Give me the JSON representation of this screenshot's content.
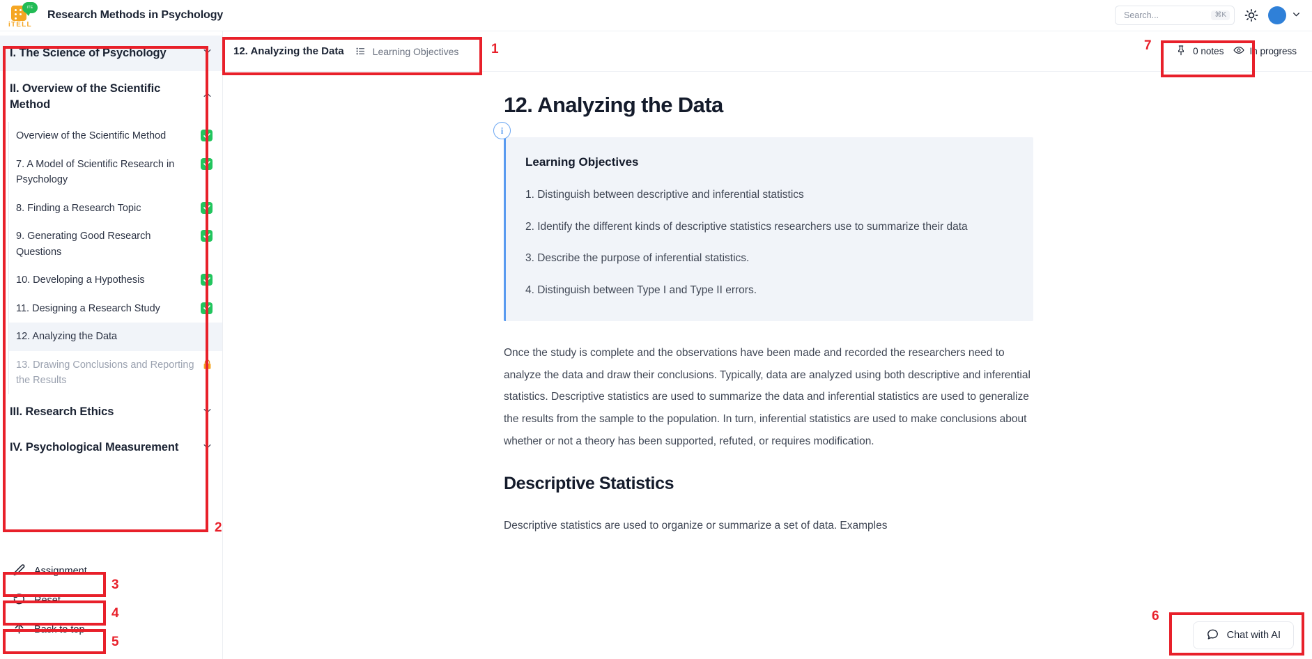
{
  "app": {
    "title": "Research Methods in Psychology",
    "logo_word": "iTELL",
    "logo_bubble_text": "iTE"
  },
  "search": {
    "placeholder": "Search...",
    "shortcut": "⌘K"
  },
  "header_icons": {
    "theme": "sun-icon",
    "avatar": "user-avatar",
    "avatar_color": "#2f80d8",
    "chevron": "chevron-down-icon"
  },
  "sidebar": {
    "sections": [
      {
        "label": "I. The Science of Psychology",
        "expanded": false,
        "chevron": "chevron-down-icon",
        "active": true,
        "items": []
      },
      {
        "label": "II. Overview of the Scientific Method",
        "expanded": true,
        "chevron": "chevron-up-icon",
        "active": false,
        "items": [
          {
            "label": "Overview of the Scientific Method",
            "status": "complete"
          },
          {
            "label": "7. A Model of Scientific Research in Psychology",
            "status": "complete"
          },
          {
            "label": "8. Finding a Research Topic",
            "status": "complete"
          },
          {
            "label": "9. Generating Good Research Questions",
            "status": "complete"
          },
          {
            "label": "10. Developing a Hypothesis",
            "status": "complete"
          },
          {
            "label": "11. Designing a Research Study",
            "status": "complete"
          },
          {
            "label": "12. Analyzing the Data",
            "status": "current"
          },
          {
            "label": "13. Drawing Conclusions and Reporting the Results",
            "status": "locked"
          }
        ]
      },
      {
        "label": "III. Research Ethics",
        "expanded": false,
        "chevron": "chevron-down-icon",
        "active": false,
        "items": []
      },
      {
        "label": "IV. Psychological Measurement",
        "expanded": false,
        "chevron": "chevron-down-icon",
        "active": false,
        "items": []
      }
    ],
    "actions": [
      {
        "label": "Assignment",
        "icon": "pencil-icon"
      },
      {
        "label": "Reset",
        "icon": "rotate-ccw-icon"
      },
      {
        "label": "Back to top",
        "icon": "arrow-up-icon"
      }
    ]
  },
  "breadcrumb": {
    "main": "12. Analyzing the Data",
    "list_icon": "list-icon",
    "sub": "Learning Objectives"
  },
  "page_status": {
    "notes_icon": "pin-icon",
    "notes_label": "0 notes",
    "progress_icon": "eye-icon",
    "progress_label": "In progress"
  },
  "main": {
    "title": "12. Analyzing the Data",
    "callout": {
      "icon": "info-icon",
      "heading": "Learning Objectives",
      "items": [
        "1. Distinguish between descriptive and inferential statistics",
        "2. Identify the different kinds of descriptive statistics researchers use to summarize their data",
        "3. Describe the purpose of inferential statistics.",
        "4. Distinguish between Type I and Type II errors."
      ]
    },
    "intro_paragraph": "Once the study is complete and the observations have been made and recorded the researchers need to analyze the data and draw their conclusions. Typically, data are analyzed using both descriptive and inferential statistics. Descriptive statistics are used to summarize the data and inferential statistics are used to generalize the results from the sample to the population. In turn, inferential statistics are used to make conclusions about whether or not a theory has been supported, refuted, or requires modification.",
    "section_heading": "Descriptive Statistics",
    "section_paragraph": "Descriptive statistics are used to organize or summarize a set of data. Examples"
  },
  "chat": {
    "icon": "chat-bubble-icon",
    "label": "Chat with AI"
  },
  "annotations": [
    {
      "number": "1"
    },
    {
      "number": "2"
    },
    {
      "number": "3"
    },
    {
      "number": "4"
    },
    {
      "number": "5"
    },
    {
      "number": "6"
    },
    {
      "number": "7"
    }
  ],
  "colors": {
    "annotation": "#e8202a",
    "complete": "#22c55e",
    "locked": "#f5a623",
    "accent_blue": "#5a9bf0",
    "brand_orange": "#f5a623",
    "brand_green": "#22bb55"
  }
}
